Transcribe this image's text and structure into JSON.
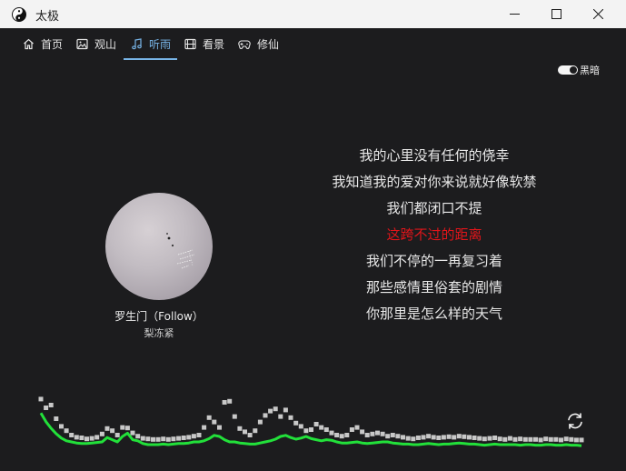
{
  "window": {
    "title": "太极",
    "icon": "yin-yang-icon"
  },
  "tabs": [
    {
      "label": "首页",
      "icon": "home-icon"
    },
    {
      "label": "观山",
      "icon": "image-icon"
    },
    {
      "label": "听雨",
      "icon": "music-note-icon",
      "active": true
    },
    {
      "label": "看景",
      "icon": "film-icon"
    },
    {
      "label": "修仙",
      "icon": "game-controller-icon"
    }
  ],
  "theme_toggle": {
    "label": "黑暗",
    "on": true
  },
  "player": {
    "title": "罗生门（Follow）",
    "artist": "梨冻紧"
  },
  "lyrics": {
    "lines": [
      "我的心里没有任何的侥幸",
      "我知道我的爱对你来说就好像软禁",
      "我们都闭口不提",
      "这跨不过的距离",
      "我们不停的一再复习着",
      "那些感情里俗套的剧情",
      "你那里是怎么样的天气"
    ],
    "current_index": 3
  },
  "colors": {
    "accent": "#78b5e8",
    "current_lyric": "#e0151a",
    "spectrum_line": "#22e03a",
    "spectrum_peak": "#c8c8c8",
    "background": "#1c1c1e"
  },
  "spectrum": {
    "levels": [
      0.63,
      0.47,
      0.35,
      0.25,
      0.17,
      0.12,
      0.1,
      0.08,
      0.07,
      0.07,
      0.08,
      0.09,
      0.1,
      0.18,
      0.14,
      0.1,
      0.2,
      0.26,
      0.14,
      0.12,
      0.07,
      0.05,
      0.05,
      0.05,
      0.06,
      0.05,
      0.06,
      0.07,
      0.07,
      0.08,
      0.1,
      0.1,
      0.12,
      0.16,
      0.22,
      0.2,
      0.14,
      0.1,
      0.1,
      0.08,
      0.07,
      0.06,
      0.06,
      0.08,
      0.1,
      0.12,
      0.15,
      0.2,
      0.22,
      0.18,
      0.15,
      0.17,
      0.2,
      0.16,
      0.14,
      0.12,
      0.14,
      0.13,
      0.1,
      0.08,
      0.08,
      0.09,
      0.1,
      0.08,
      0.07,
      0.08,
      0.09,
      0.1,
      0.1,
      0.08,
      0.07,
      0.06,
      0.06,
      0.05,
      0.05,
      0.06,
      0.07,
      0.06,
      0.05,
      0.06,
      0.06,
      0.07,
      0.08,
      0.07,
      0.06,
      0.06,
      0.05,
      0.04,
      0.05,
      0.06,
      0.05,
      0.05,
      0.05,
      0.05,
      0.04,
      0.05,
      0.05,
      0.04,
      0.04,
      0.05,
      0.05,
      0.04,
      0.04,
      0.05,
      0.04,
      0.04,
      0.03
    ],
    "peaks": [
      0.86,
      0.7,
      0.75,
      0.5,
      0.36,
      0.28,
      0.2,
      0.16,
      0.15,
      0.13,
      0.14,
      0.16,
      0.22,
      0.32,
      0.28,
      0.2,
      0.34,
      0.33,
      0.24,
      0.18,
      0.14,
      0.13,
      0.12,
      0.12,
      0.13,
      0.12,
      0.13,
      0.14,
      0.15,
      0.16,
      0.18,
      0.2,
      0.34,
      0.52,
      0.44,
      0.34,
      0.8,
      0.82,
      0.54,
      0.32,
      0.26,
      0.2,
      0.28,
      0.44,
      0.56,
      0.64,
      0.68,
      0.54,
      0.66,
      0.52,
      0.42,
      0.36,
      0.28,
      0.3,
      0.4,
      0.34,
      0.3,
      0.24,
      0.2,
      0.18,
      0.2,
      0.3,
      0.34,
      0.26,
      0.2,
      0.22,
      0.24,
      0.22,
      0.18,
      0.2,
      0.18,
      0.16,
      0.14,
      0.13,
      0.15,
      0.16,
      0.18,
      0.16,
      0.15,
      0.16,
      0.17,
      0.16,
      0.18,
      0.17,
      0.16,
      0.15,
      0.14,
      0.13,
      0.14,
      0.15,
      0.13,
      0.12,
      0.14,
      0.12,
      0.13,
      0.12,
      0.12,
      0.12,
      0.11,
      0.13,
      0.12,
      0.12,
      0.11,
      0.13,
      0.12,
      0.11,
      0.11
    ]
  },
  "refresh_button": {
    "icon": "refresh-icon"
  }
}
